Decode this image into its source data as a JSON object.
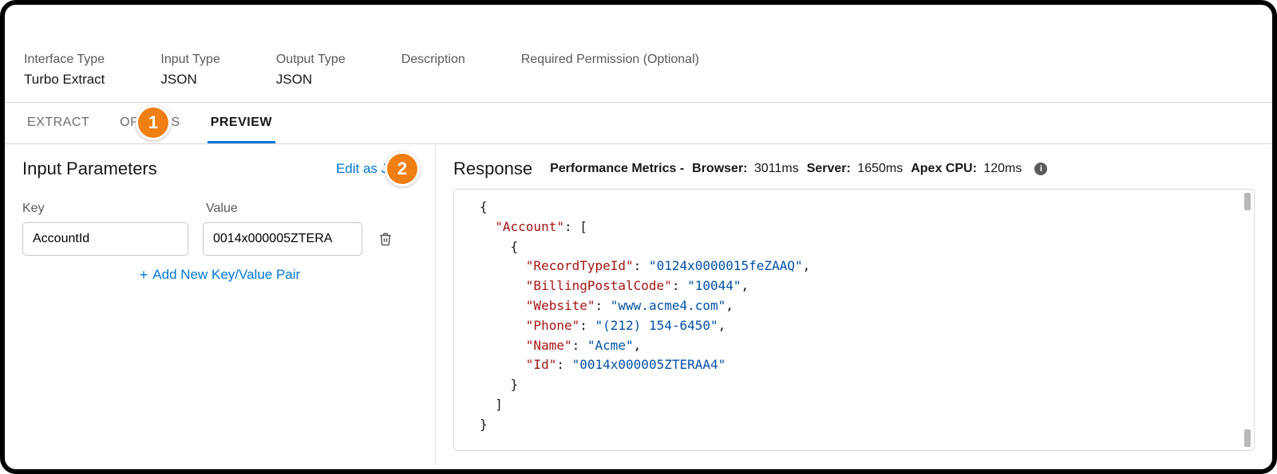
{
  "summary": [
    {
      "label": "Interface Type",
      "value": "Turbo Extract"
    },
    {
      "label": "Input Type",
      "value": "JSON"
    },
    {
      "label": "Output Type",
      "value": "JSON"
    },
    {
      "label": "Description",
      "value": ""
    },
    {
      "label": "Required Permission (Optional)",
      "value": ""
    }
  ],
  "tabs": {
    "items": [
      "EXTRACT",
      "OPTIONS",
      "PREVIEW"
    ],
    "activeIndex": 2
  },
  "inputParams": {
    "title": "Input Parameters",
    "editLabel": "Edit as JSON",
    "keyHeader": "Key",
    "valueHeader": "Value",
    "rows": [
      {
        "key": "AccountId",
        "value": "0014x000005ZTERA"
      }
    ],
    "addLabel": "Add New Key/Value Pair"
  },
  "responsePanel": {
    "title": "Response",
    "metricsLabel": "Performance Metrics -",
    "metrics": [
      {
        "label": "Browser:",
        "value": "3011ms"
      },
      {
        "label": "Server:",
        "value": "1650ms"
      },
      {
        "label": "Apex CPU:",
        "value": "120ms"
      }
    ],
    "json": {
      "Account": [
        {
          "RecordTypeId": "0124x0000015feZAAQ",
          "BillingPostalCode": "10044",
          "Website": "www.acme4.com",
          "Phone": "(212) 154-6450",
          "Name": "Acme",
          "Id": "0014x000005ZTERAA4"
        }
      ]
    }
  },
  "callouts": [
    "1",
    "2"
  ]
}
